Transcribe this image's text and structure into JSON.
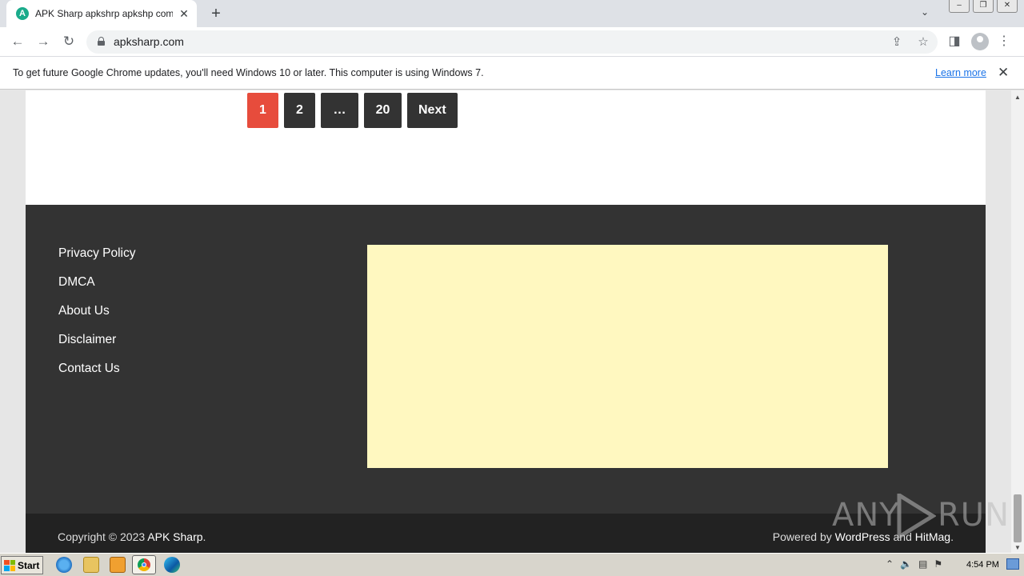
{
  "browser": {
    "tab_title": "APK Sharp apkshrp apkshp com - Yo",
    "favicon_letter": "A",
    "url": "apksharp.com"
  },
  "infobar": {
    "message": "To get future Google Chrome updates, you'll need Windows 10 or later. This computer is using Windows 7.",
    "link_label": "Learn more"
  },
  "pagination": {
    "pages": [
      "1",
      "2",
      "…",
      "20"
    ],
    "next_label": "Next"
  },
  "footer": {
    "links": [
      "Privacy Policy",
      "DMCA",
      "About Us",
      "Disclaimer",
      "Contact Us"
    ],
    "copyright_prefix": "Copyright © 2023 ",
    "site_name": "APK Sharp",
    "copyright_suffix": ".",
    "powered_prefix": "Powered by ",
    "powered_wp": "WordPress",
    "powered_and": " and ",
    "powered_theme": "HitMag",
    "powered_suffix": "."
  },
  "watermark": {
    "text_left": "ANY",
    "text_right": "RUN"
  },
  "taskbar": {
    "start_label": "Start",
    "clock": "4:54 PM"
  },
  "colors": {
    "active_page": "#e74c3c",
    "page_button": "#333333",
    "footer_bg": "#333333",
    "ad_box": "#fff8c0",
    "link_blue": "#1a73e8"
  }
}
